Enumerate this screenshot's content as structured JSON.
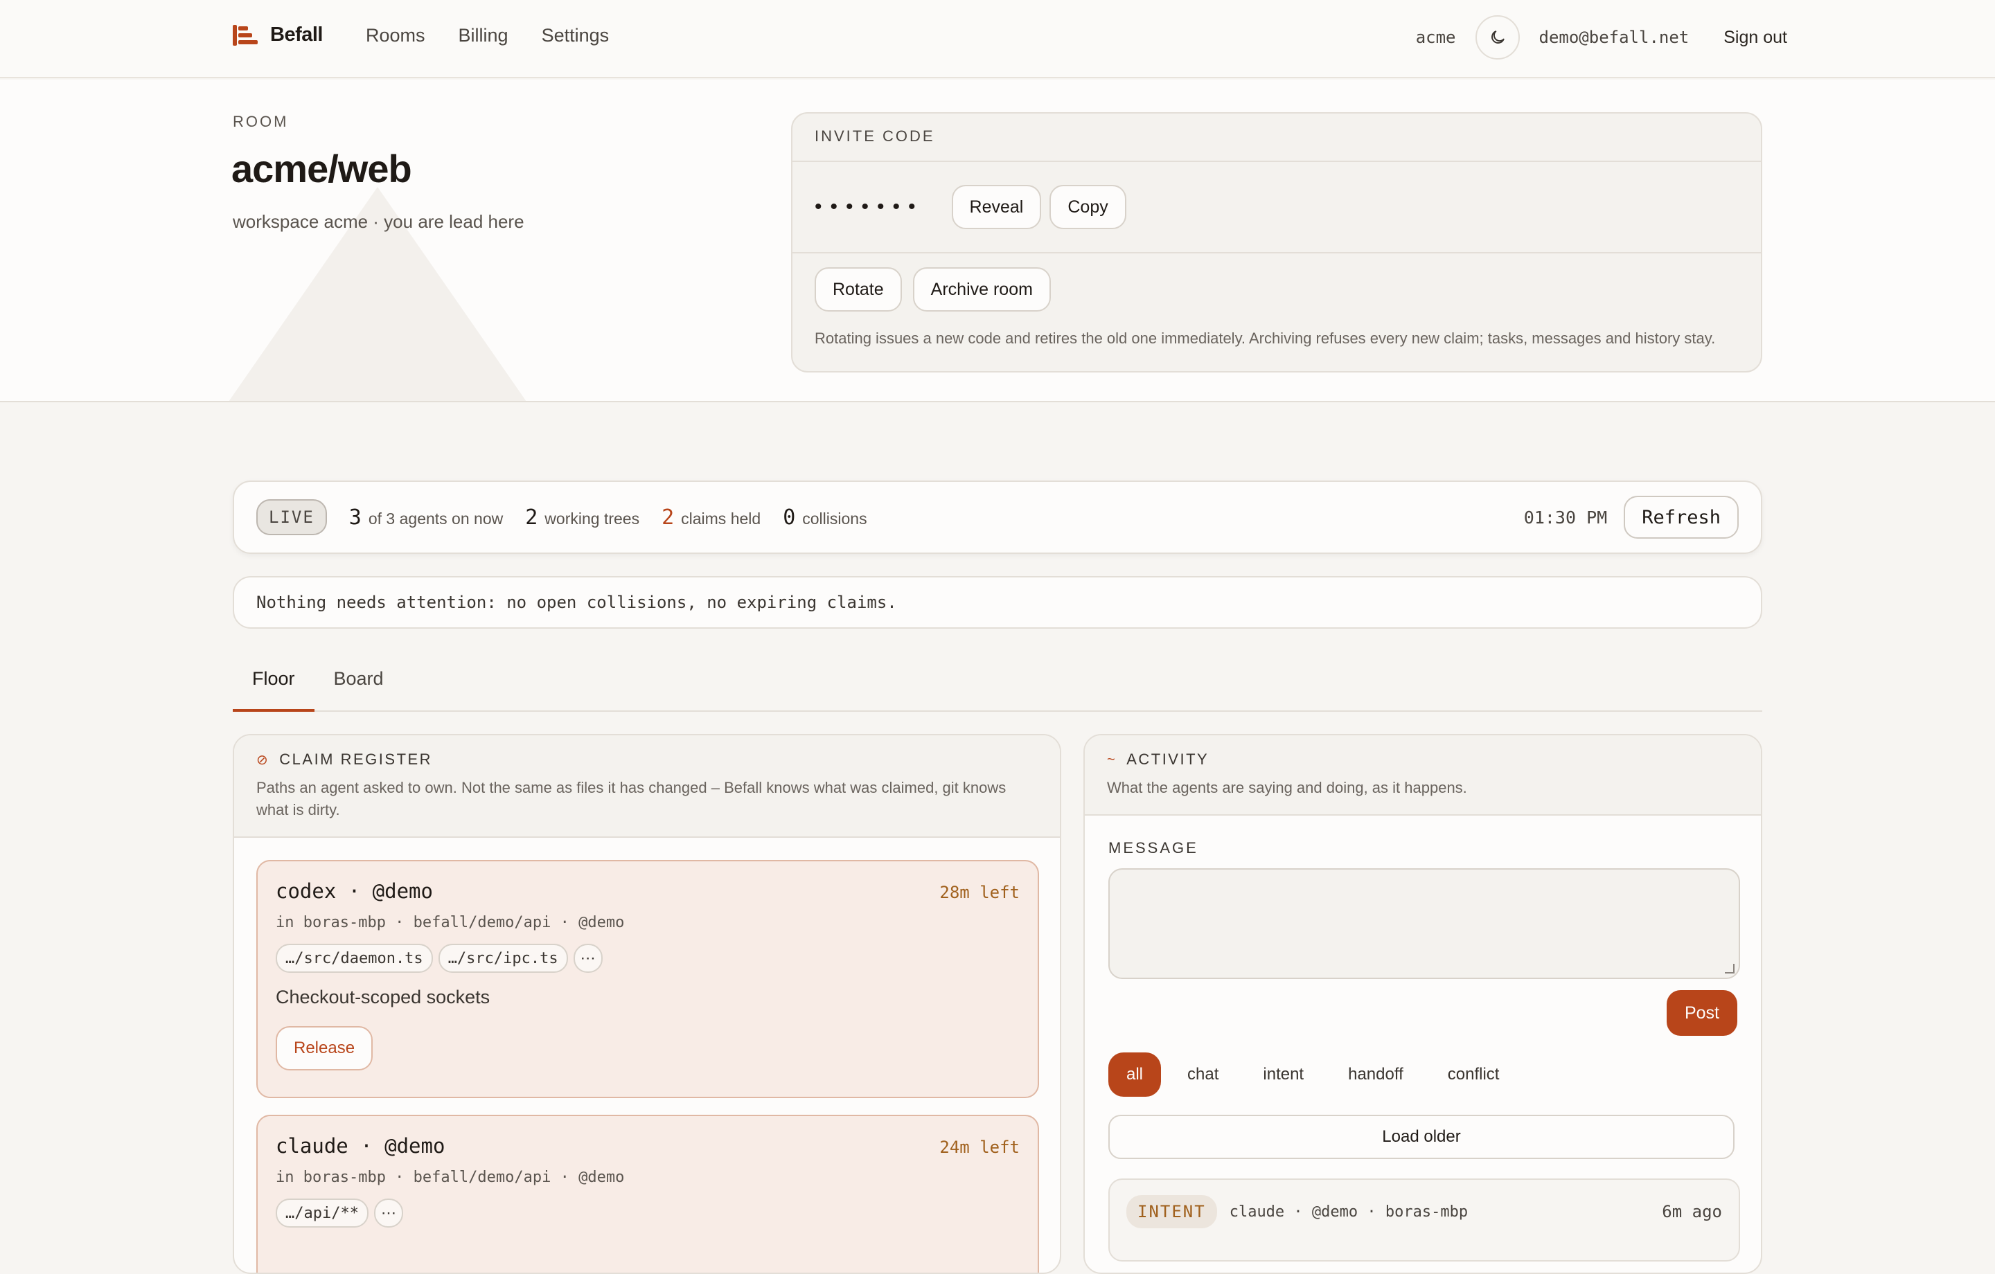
{
  "app": {
    "brand": "Befall",
    "nav": [
      "Rooms",
      "Billing",
      "Settings"
    ],
    "workspace": "acme",
    "user_email": "demo@befall.net",
    "sign_out": "Sign out",
    "accent_color": "#b8451a"
  },
  "room": {
    "eyebrow": "ROOM",
    "title": "acme/web",
    "subtitle": "workspace acme · you are lead here"
  },
  "invite": {
    "heading": "INVITE CODE",
    "masked_code": "•••••••",
    "reveal": "Reveal",
    "copy": "Copy",
    "rotate": "Rotate",
    "archive": "Archive room",
    "note": "Rotating issues a new code and retires the old one immediately. Archiving refuses every new claim; tasks, messages and history stay."
  },
  "status": {
    "live": "LIVE",
    "agents_num": "3",
    "agents_label": "of 3 agents on now",
    "trees_num": "2",
    "trees_label": "working trees",
    "claims_num": "2",
    "claims_label": "claims held",
    "collisions_num": "0",
    "collisions_label": "collisions",
    "time": "01:30 PM",
    "refresh": "Refresh"
  },
  "attention": "Nothing needs attention: no open collisions, no expiring claims.",
  "tabs": [
    "Floor",
    "Board"
  ],
  "claims": {
    "title": "CLAIM REGISTER",
    "icon": "⊘",
    "desc": "Paths an agent asked to own. Not the same as files it has changed – Befall knows what was claimed, git knows what is dirty.",
    "items": [
      {
        "agent": "codex · @demo",
        "time_left": "28m left",
        "location": "in boras-mbp · befall/demo/api · @demo",
        "paths": [
          "…/src/daemon.ts",
          "…/src/ipc.ts"
        ],
        "more": "⋯",
        "note": "Checkout-scoped sockets",
        "release": "Release"
      },
      {
        "agent": "claude · @demo",
        "time_left": "24m left",
        "location": "in boras-mbp · befall/demo/api · @demo",
        "paths": [
          "…/api/**"
        ],
        "more": "⋯"
      }
    ]
  },
  "activity": {
    "title": "ACTIVITY",
    "icon": "~",
    "desc": "What the agents are saying and doing, as it happens.",
    "message_label": "MESSAGE",
    "post": "Post",
    "filters": [
      "all",
      "chat",
      "intent",
      "handoff",
      "conflict"
    ],
    "load_older": "Load older",
    "items": [
      {
        "kind": "INTENT",
        "meta": "claude · @demo · boras-mbp",
        "time": "6m ago"
      }
    ]
  }
}
